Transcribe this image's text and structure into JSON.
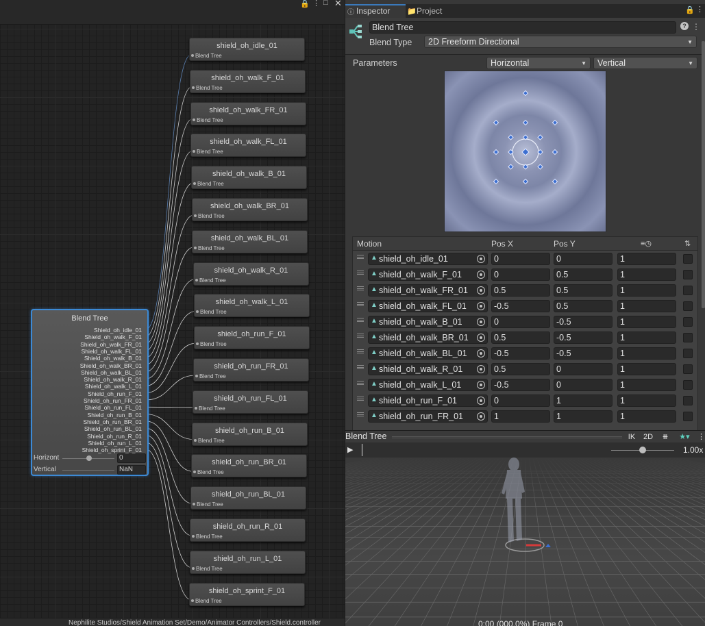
{
  "graph": {
    "path": "Nephilite Studios/Shield Animation Set/Demo/Animator Controllers/Shield.controller",
    "nodes": [
      {
        "name": "shield_oh_idle_01",
        "sub": "Blend Tree"
      },
      {
        "name": "shield_oh_walk_F_01",
        "sub": "Blend Tree"
      },
      {
        "name": "shield_oh_walk_FR_01",
        "sub": "Blend Tree"
      },
      {
        "name": "shield_oh_walk_FL_01",
        "sub": "Blend Tree"
      },
      {
        "name": "shield_oh_walk_B_01",
        "sub": "Blend Tree"
      },
      {
        "name": "shield_oh_walk_BR_01",
        "sub": "Blend Tree"
      },
      {
        "name": "shield_oh_walk_BL_01",
        "sub": "Blend Tree"
      },
      {
        "name": "shield_oh_walk_R_01",
        "sub": "Blend Tree"
      },
      {
        "name": "shield_oh_walk_L_01",
        "sub": "Blend Tree"
      },
      {
        "name": "shield_oh_run_F_01",
        "sub": "Blend Tree"
      },
      {
        "name": "shield_oh_run_FR_01",
        "sub": "Blend Tree"
      },
      {
        "name": "shield_oh_run_FL_01",
        "sub": "Blend Tree"
      },
      {
        "name": "shield_oh_run_B_01",
        "sub": "Blend Tree"
      },
      {
        "name": "shield_oh_run_BR_01",
        "sub": "Blend Tree"
      },
      {
        "name": "shield_oh_run_BL_01",
        "sub": "Blend Tree"
      },
      {
        "name": "shield_oh_run_R_01",
        "sub": "Blend Tree"
      },
      {
        "name": "shield_oh_run_L_01",
        "sub": "Blend Tree"
      },
      {
        "name": "shield_oh_sprint_F_01",
        "sub": "Blend Tree"
      }
    ],
    "blend_tree_node": {
      "title": "Blend Tree",
      "children": [
        "Shield_oh_idle_01",
        "Shield_oh_walk_F_01",
        "Shield_oh_walk_FR_01",
        "Shield_oh_walk_FL_01",
        "Shield_oh_walk_B_01",
        "Shield_oh_walk_BR_01",
        "Shield_oh_walk_BL_01",
        "Shield_oh_walk_R_01",
        "Shield_oh_walk_L_01",
        "Shield_oh_run_F_01",
        "Shield_oh_run_FR_01",
        "Shield_oh_run_FL_01",
        "Shield_oh_run_B_01",
        "Shield_oh_run_BR_01",
        "Shield_oh_run_BL_01",
        "Shield_oh_run_R_01",
        "Shield_oh_run_L_01",
        "Shield_oh_sprint_F_01"
      ],
      "param1": {
        "label": "Horizont",
        "value": "0"
      },
      "param2": {
        "label": "Vertical",
        "value": "NaN"
      }
    }
  },
  "inspector": {
    "tabs": {
      "inspector": "Inspector",
      "project": "Project"
    },
    "name": "Blend Tree",
    "blend_type_label": "Blend Type",
    "blend_type": "2D Freeform Directional",
    "parameters_label": "Parameters",
    "param_x": "Horizontal",
    "param_y": "Vertical",
    "columns": {
      "motion": "Motion",
      "posx": "Pos X",
      "posy": "Pos Y"
    },
    "motions": [
      {
        "name": "shield_oh_idle_01",
        "x": "0",
        "y": "0",
        "speed": "1"
      },
      {
        "name": "shield_oh_walk_F_01",
        "x": "0",
        "y": "0.5",
        "speed": "1"
      },
      {
        "name": "shield_oh_walk_FR_01",
        "x": "0.5",
        "y": "0.5",
        "speed": "1"
      },
      {
        "name": "shield_oh_walk_FL_01",
        "x": "-0.5",
        "y": "0.5",
        "speed": "1"
      },
      {
        "name": "shield_oh_walk_B_01",
        "x": "0",
        "y": "-0.5",
        "speed": "1"
      },
      {
        "name": "shield_oh_walk_BR_01",
        "x": "0.5",
        "y": "-0.5",
        "speed": "1"
      },
      {
        "name": "shield_oh_walk_BL_01",
        "x": "-0.5",
        "y": "-0.5",
        "speed": "1"
      },
      {
        "name": "shield_oh_walk_R_01",
        "x": "0.5",
        "y": "0",
        "speed": "1"
      },
      {
        "name": "shield_oh_walk_L_01",
        "x": "-0.5",
        "y": "0",
        "speed": "1"
      },
      {
        "name": "shield_oh_run_F_01",
        "x": "0",
        "y": "1",
        "speed": "1"
      },
      {
        "name": "shield_oh_run_FR_01",
        "x": "1",
        "y": "1",
        "speed": "1"
      }
    ]
  },
  "preview": {
    "title": "Blend Tree",
    "ik": "IK",
    "mode_2d": "2D",
    "speed": "1.00x",
    "frame": "0:00 (000.0%) Frame 0"
  },
  "colors": {
    "accent": "#3a79bb",
    "selection": "#3c8ad6",
    "clip_icon": "#7fd0c8"
  }
}
